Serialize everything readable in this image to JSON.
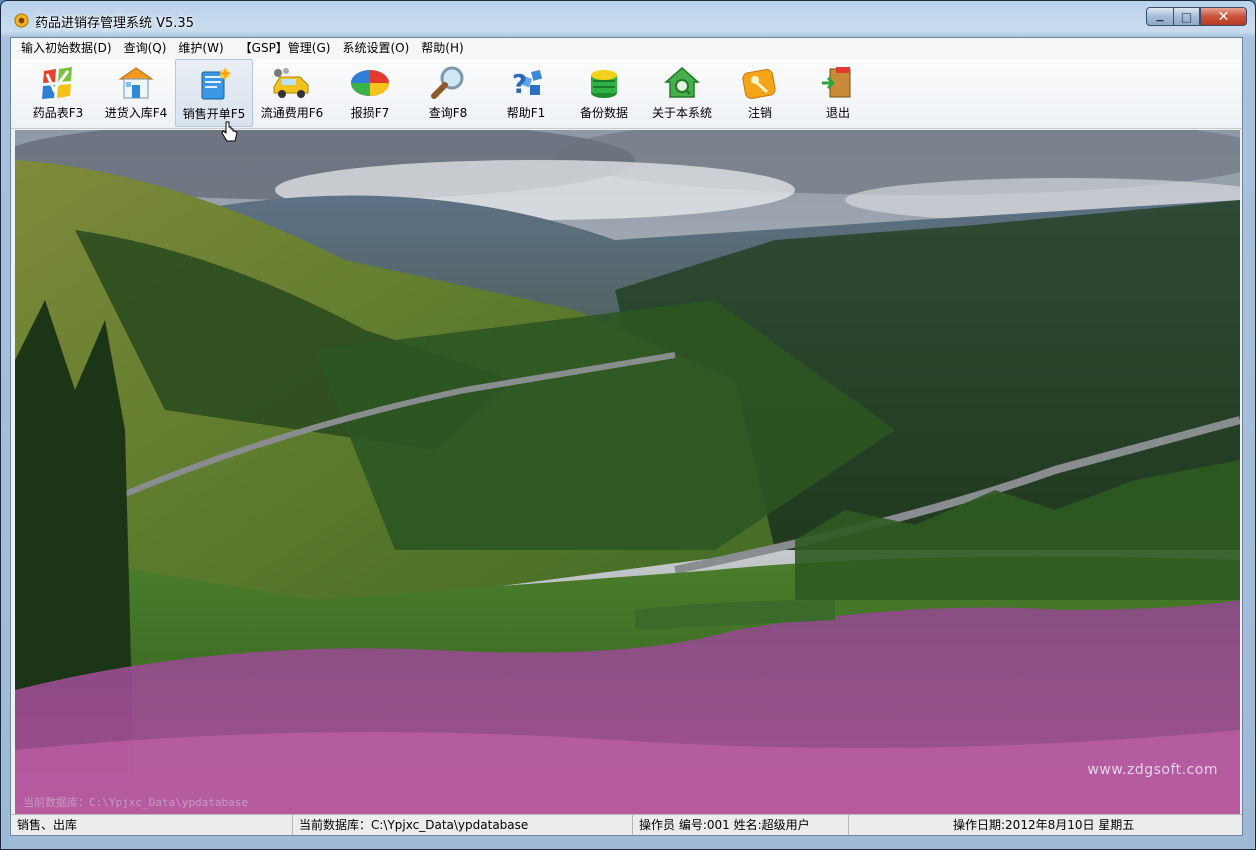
{
  "window": {
    "title": "药品进销存管理系统 V5.35",
    "caption": {
      "minimize": "▁",
      "maximize": "□",
      "close": "✕"
    }
  },
  "menu": [
    {
      "label": "输入初始数据(D)"
    },
    {
      "label": "查询(Q)"
    },
    {
      "label": "维护(W)"
    },
    {
      "label": "【GSP】管理(G)"
    },
    {
      "label": "系统设置(O)"
    },
    {
      "label": "帮助(H)"
    }
  ],
  "toolbar": [
    {
      "label": "药品表F3",
      "icon": "medicine-list-icon"
    },
    {
      "label": "进货入库F4",
      "icon": "stock-in-icon"
    },
    {
      "label": "销售开单F5",
      "icon": "sales-order-icon",
      "state": "hover"
    },
    {
      "label": "流通费用F6",
      "icon": "expense-icon"
    },
    {
      "label": "报损F7",
      "icon": "loss-report-icon"
    },
    {
      "label": "查询F8",
      "icon": "search-icon"
    },
    {
      "label": "帮助F1",
      "icon": "help-icon"
    },
    {
      "label": "备份数据",
      "icon": "backup-icon"
    },
    {
      "label": "关于本系统",
      "icon": "about-icon"
    },
    {
      "label": "注销",
      "icon": "logout-key-icon"
    },
    {
      "label": "退出",
      "icon": "exit-door-icon"
    }
  ],
  "background": {
    "watermark": "www.zdgsoft.com",
    "ghost_status": "当前数据库：C:\\Ypjxc_Data\\ypdatabase"
  },
  "status": {
    "mode": "销售、出库",
    "database": "当前数据库：C:\\Ypjxc_Data\\ypdatabase",
    "operator": "操作员 编号:001  姓名:超级用户",
    "date": "操作日期:2012年8月10日 星期五"
  }
}
